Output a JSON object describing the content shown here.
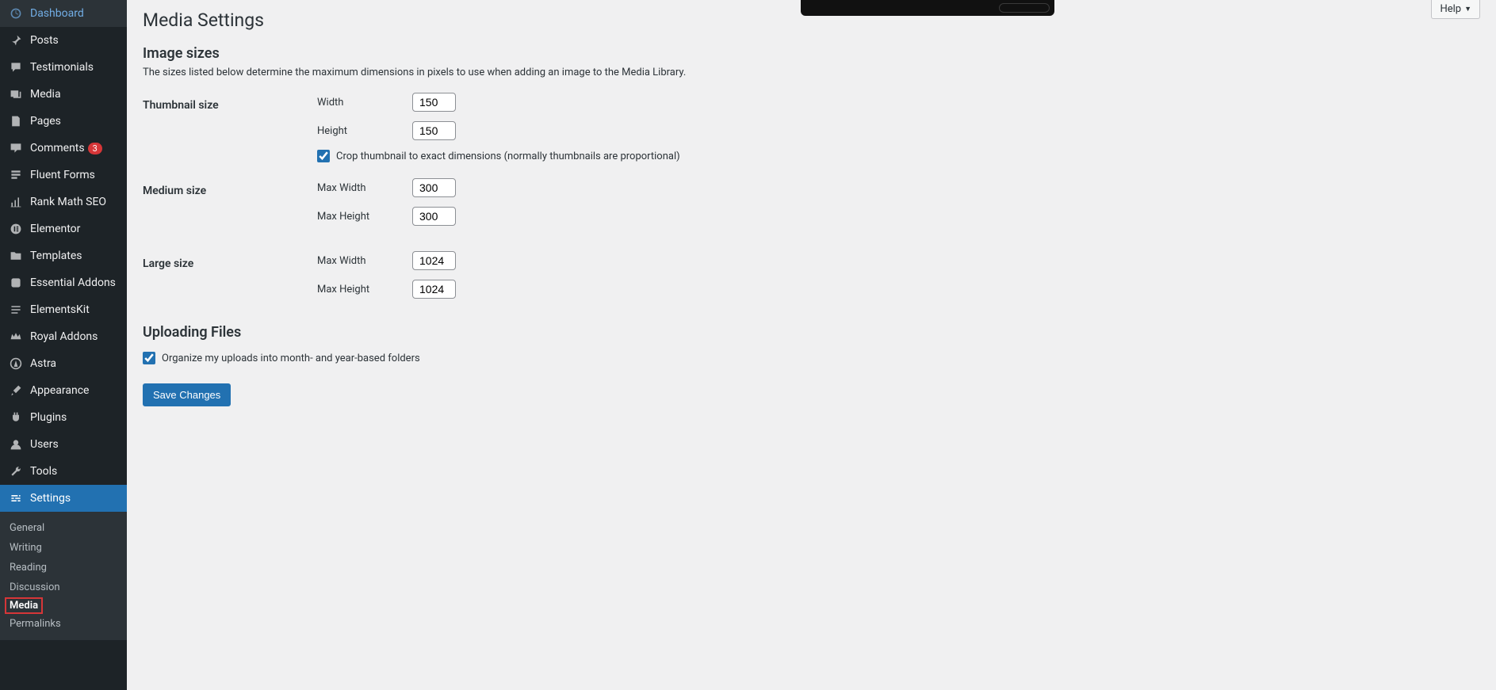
{
  "help_label": "Help",
  "page_title": "Media Settings",
  "section_image_sizes": "Image sizes",
  "image_sizes_desc": "The sizes listed below determine the maximum dimensions in pixels to use when adding an image to the Media Library.",
  "rows": {
    "thumbnail_label": "Thumbnail size",
    "width_label": "Width",
    "height_label": "Height",
    "crop_label": "Crop thumbnail to exact dimensions (normally thumbnails are proportional)",
    "medium_label": "Medium size",
    "maxwidth_label": "Max Width",
    "maxheight_label": "Max Height",
    "large_label": "Large size"
  },
  "values": {
    "thumb_w": "150",
    "thumb_h": "150",
    "med_w": "300",
    "med_h": "300",
    "lg_w": "1024",
    "lg_h": "1024"
  },
  "section_uploading": "Uploading Files",
  "organize_label": "Organize my uploads into month- and year-based folders",
  "save_button": "Save Changes",
  "sidebar": {
    "dashboard": "Dashboard",
    "posts": "Posts",
    "testimonials": "Testimonials",
    "media": "Media",
    "pages": "Pages",
    "comments": "Comments",
    "comments_badge": "3",
    "fluentforms": "Fluent Forms",
    "rankmath": "Rank Math SEO",
    "elementor": "Elementor",
    "templates": "Templates",
    "essential_addons": "Essential Addons",
    "elementskit": "ElementsKit",
    "royal_addons": "Royal Addons",
    "astra": "Astra",
    "appearance": "Appearance",
    "plugins": "Plugins",
    "users": "Users",
    "tools": "Tools",
    "settings": "Settings"
  },
  "submenu": {
    "general": "General",
    "writing": "Writing",
    "reading": "Reading",
    "discussion": "Discussion",
    "media": "Media",
    "permalinks": "Permalinks"
  }
}
